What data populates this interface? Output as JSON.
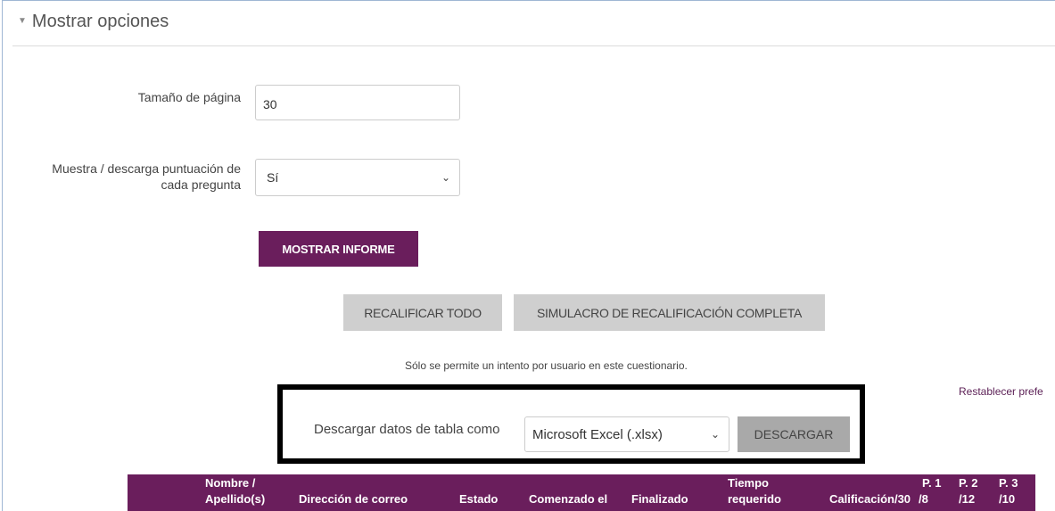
{
  "section": {
    "title": "Mostrar opciones"
  },
  "page_size": {
    "label": "Tamaño de página",
    "value": "30"
  },
  "show_marks": {
    "label_line1": "Muestra / descarga puntuación de",
    "label_line2": "cada pregunta",
    "value": "Sí"
  },
  "buttons": {
    "show_report": "MOSTRAR INFORME",
    "regrade_all": "RECALIFICAR TODO",
    "dry_run": "SIMULACRO DE RECALIFICACIÓN COMPLETA",
    "download": "DESCARGAR"
  },
  "note": "Sólo se permite un intento por usuario en este cuestionario.",
  "reset_link": "Restablecer prefe",
  "download": {
    "label": "Descargar datos de tabla como",
    "format": "Microsoft Excel (.xlsx)"
  },
  "table": {
    "headers": {
      "name_1": "Nombre /",
      "name_2": "Apellido(s)",
      "email": "Dirección de correo",
      "state": "Estado",
      "started": "Comenzado el",
      "finished": "Finalizado",
      "time_1": "Tiempo",
      "time_2": "requerido",
      "grade": "Calificación/30",
      "q1_1": "P. 1",
      "q1_2": "/8",
      "q2_1": "P. 2",
      "q2_2": "/12",
      "q3_1": "P. 3",
      "q3_2": "/10"
    }
  },
  "icons": {
    "collapse": "triangle-down-icon",
    "select": "chevron-down-icon"
  },
  "colors": {
    "primary": "#6a1e5c",
    "secondary_button": "#cfcfcf"
  }
}
